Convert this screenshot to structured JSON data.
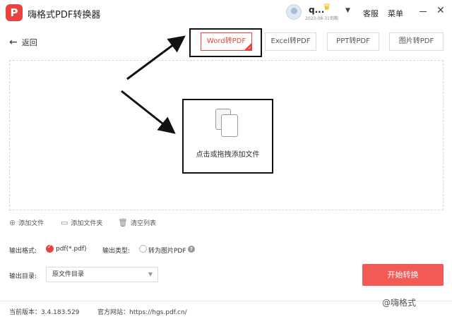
{
  "app": {
    "logo_glyph": "P",
    "title": "嗨格式PDF转换器"
  },
  "user": {
    "name": "q...",
    "expiry": "2023-08-31到期",
    "crown_icon": "crown-icon"
  },
  "header_menu": {
    "service": "客服",
    "menu": "菜单"
  },
  "nav": {
    "back": "返回"
  },
  "tabs": [
    {
      "label": "Word转PDF",
      "active": true
    },
    {
      "label": "Excel转PDF",
      "active": false
    },
    {
      "label": "PPT转PDF",
      "active": false
    },
    {
      "label": "图片转PDF",
      "active": false
    }
  ],
  "dropzone": {
    "text": "点击或拖拽添加文件"
  },
  "actions": {
    "add_file": "添加文件",
    "add_folder": "添加文件夹",
    "clear_list": "清空列表"
  },
  "output": {
    "format_label": "输出格式:",
    "format_value": "pdf(*.pdf)",
    "type_label": "输出类型:",
    "type_option": "转为图片PDF",
    "dir_label": "输出目录:",
    "dir_value": "原文件目录"
  },
  "start_button": "开始转换",
  "footer": {
    "version": "当前版本：3.4.183.529",
    "website": "官方网站：https://hgs.pdf.cn/"
  },
  "watermark": "@嗨格式",
  "colors": {
    "accent": "#e8443f",
    "button": "#f15a55"
  }
}
